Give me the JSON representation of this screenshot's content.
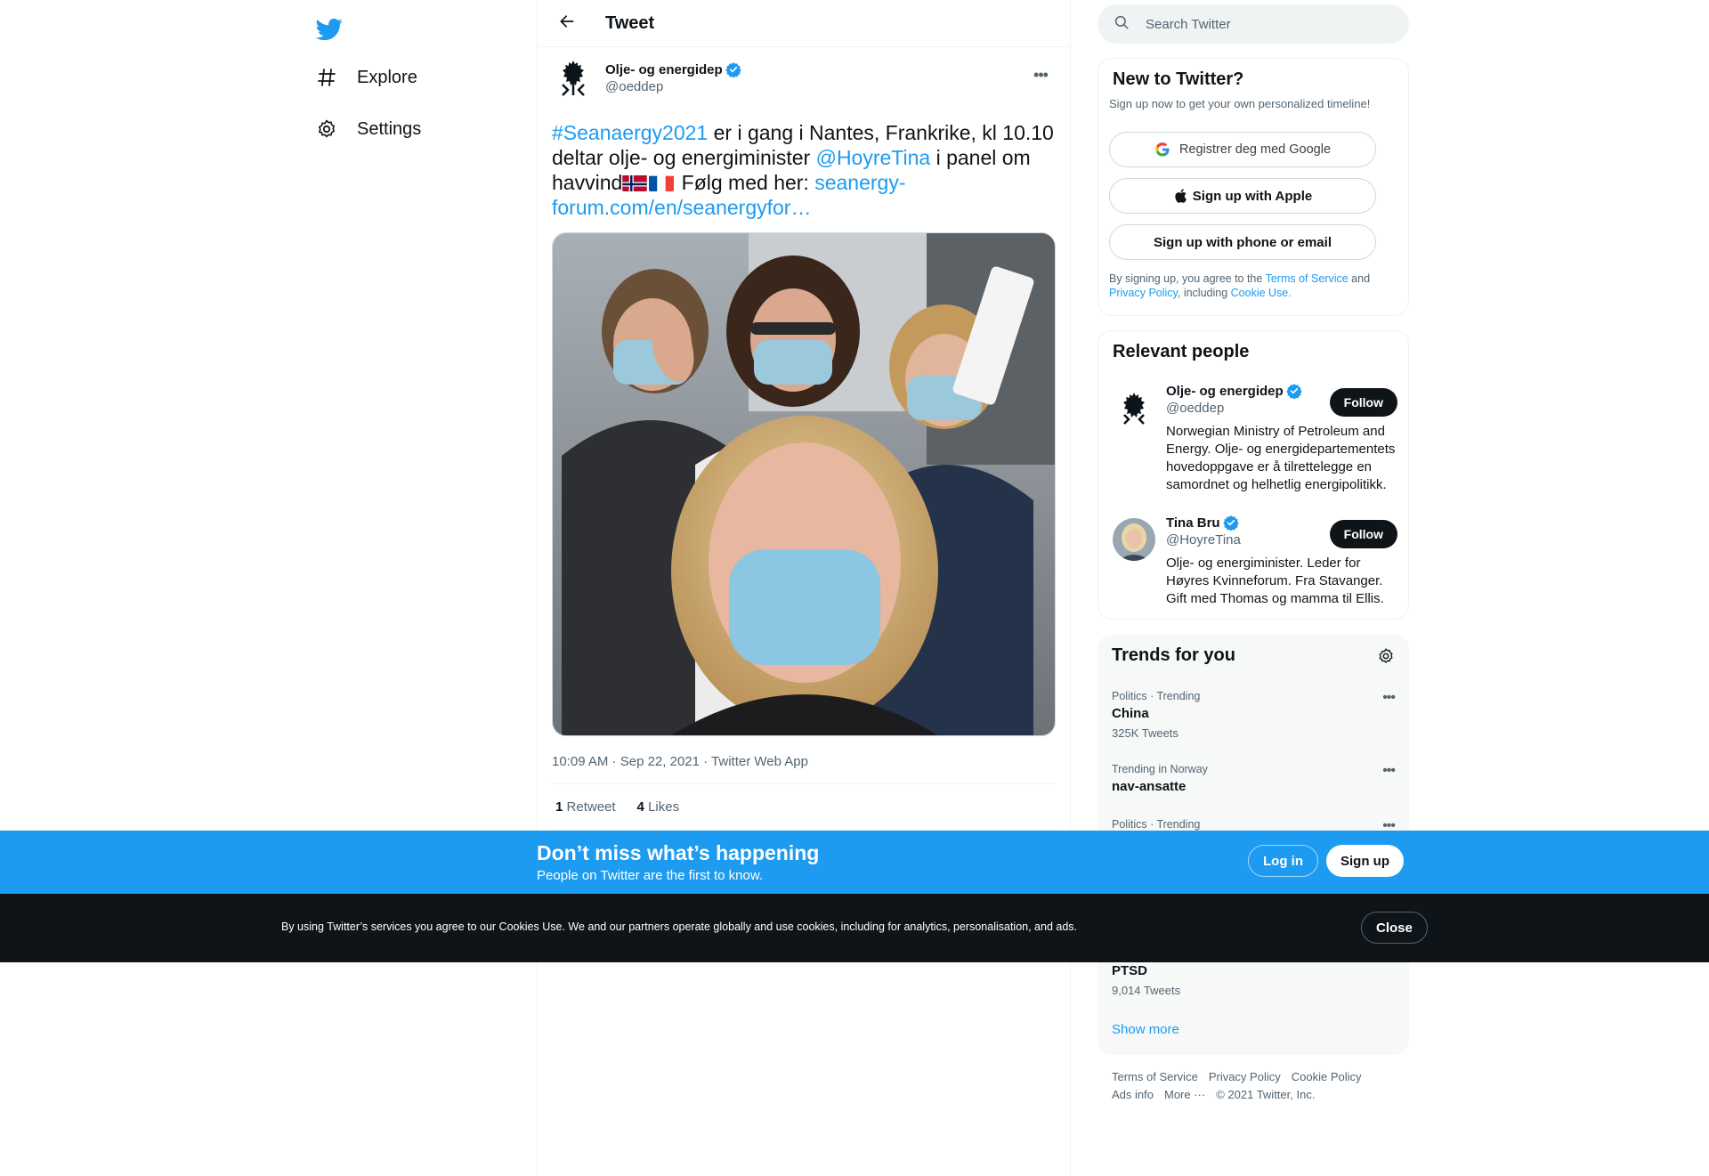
{
  "nav": {
    "logo": "twitter-bird-icon",
    "items": [
      {
        "label": "Explore",
        "icon": "hashtag-icon"
      },
      {
        "label": "Settings",
        "icon": "gear-icon"
      }
    ]
  },
  "main": {
    "header_title": "Tweet",
    "tweet": {
      "author_name": "Olje- og energidep",
      "author_handle": "@oeddep",
      "text": {
        "hashtag": "#Seanaergy2021",
        "part1": " er i gang i Nantes, Frankrike, kl 10.10 deltar olje- og energiminister ",
        "mention": "@HoyreTina",
        "part2": "  i panel om havvind",
        "part3": " Følg med her: ",
        "link": "seanergy-forum.com/en/seanergyfor…"
      },
      "timestamp_time": "10:09 AM",
      "timestamp_sep1": " · ",
      "timestamp_date": "Sep 22, 2021",
      "timestamp_sep2": " · ",
      "timestamp_source": "Twitter Web App",
      "retweets_count": "1",
      "retweets_label": "Retweet",
      "likes_count": "4",
      "likes_label": "Likes"
    }
  },
  "right": {
    "search_placeholder": "Search Twitter",
    "new_to_twitter": {
      "title": "New to Twitter?",
      "subtitle": "Sign up now to get your own personalized timeline!",
      "google_btn": "Registrer deg med Google",
      "apple_btn": "Sign up with Apple",
      "phone_btn": "Sign up with phone or email",
      "legal_1": "By signing up, you agree to the ",
      "legal_terms": "Terms of Service",
      "legal_2": " and ",
      "legal_privacy": "Privacy Policy",
      "legal_3": ", including ",
      "legal_cookie": "Cookie Use."
    },
    "relevant_people": {
      "title": "Relevant people",
      "people": [
        {
          "name": "Olje- og energidep",
          "handle": "@oeddep",
          "bio": "Norwegian Ministry of Petroleum and Energy. Olje- og energidepartementets hovedoppgave er å tilrettelegge en samordnet og helhetlig energipolitikk.",
          "follow": "Follow"
        },
        {
          "name": "Tina Bru",
          "handle": "@HoyreTina",
          "bio": "Olje- og energiminister. Leder for Høyres Kvinneforum. Fra Stavanger. Gift med Thomas og mamma til Ellis.",
          "follow": "Follow"
        }
      ]
    },
    "trends": {
      "title": "Trends for you",
      "items": [
        {
          "meta": "Politics · Trending",
          "name": "China",
          "count": "325K Tweets"
        },
        {
          "meta": "Trending in Norway",
          "name": "nav-ansatte",
          "count": ""
        },
        {
          "meta": "Politics · Trending",
          "name": "",
          "count": ""
        },
        {
          "meta": "",
          "name": "PTSD",
          "count": "9,014 Tweets"
        }
      ],
      "show_more": "Show more"
    },
    "footer": {
      "links": [
        "Terms of Service",
        "Privacy Policy",
        "Cookie Policy",
        "Ads info",
        "More ···",
        "© 2021 Twitter, Inc."
      ]
    }
  },
  "signup_bar": {
    "headline": "Don’t miss what’s happening",
    "sub": "People on Twitter are the first to know.",
    "login": "Log in",
    "signup": "Sign up"
  },
  "cookie_bar": {
    "text": "By using Twitter’s services you agree to our Cookies Use. We and our partners operate globally and use cookies, including for analytics, personalisation, and ads.",
    "close": "Close"
  },
  "colors": {
    "accent": "#1d9bf0",
    "text": "#0f1419",
    "muted": "#536471",
    "cookie_bg": "#0f1419"
  }
}
